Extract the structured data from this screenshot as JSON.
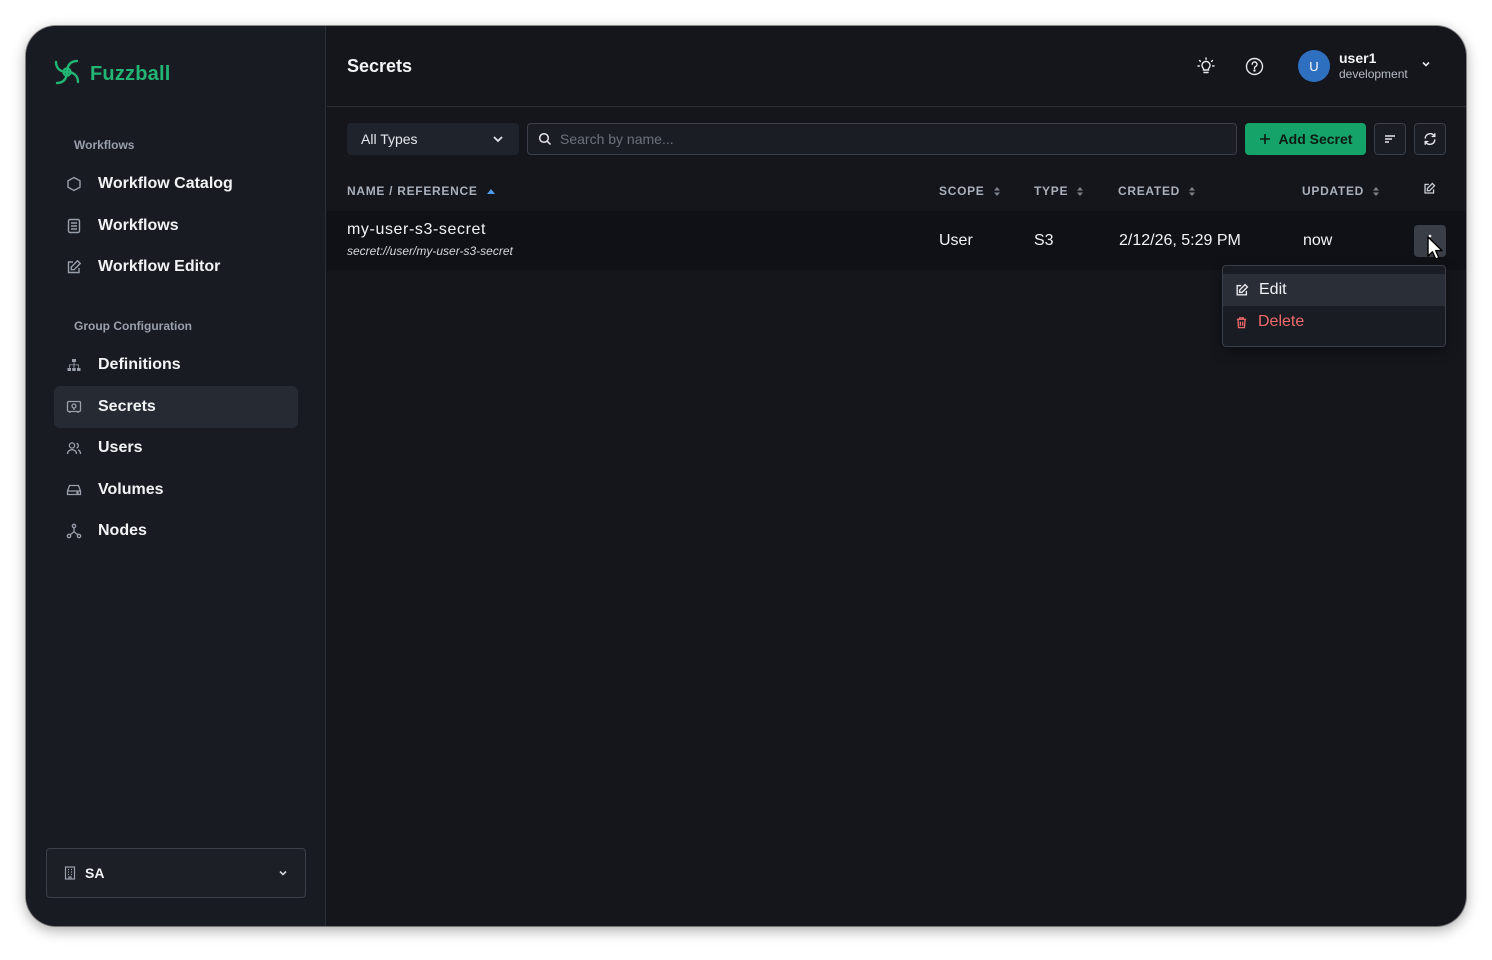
{
  "app": {
    "name": "Fuzzball",
    "brand_color": "#22b573"
  },
  "sidebar": {
    "sections": [
      {
        "label": "Workflows",
        "items": [
          {
            "label": "Workflow Catalog",
            "icon": "hexagon-icon"
          },
          {
            "label": "Workflows",
            "icon": "list-icon"
          },
          {
            "label": "Workflow Editor",
            "icon": "edit-icon"
          }
        ]
      },
      {
        "label": "Group Configuration",
        "items": [
          {
            "label": "Definitions",
            "icon": "sitemap-icon"
          },
          {
            "label": "Secrets",
            "icon": "secret-icon",
            "active": true
          },
          {
            "label": "Users",
            "icon": "users-icon"
          },
          {
            "label": "Volumes",
            "icon": "hard-drive-icon"
          },
          {
            "label": "Nodes",
            "icon": "nodes-icon"
          }
        ]
      }
    ],
    "org": "SA"
  },
  "header": {
    "title": "Secrets",
    "user": {
      "initial": "U",
      "name": "user1",
      "env": "development"
    }
  },
  "toolbar": {
    "type_filter": "All Types",
    "search_placeholder": "Search by name...",
    "add_label": "Add Secret"
  },
  "table": {
    "columns": [
      "NAME / REFERENCE",
      "SCOPE",
      "TYPE",
      "CREATED",
      "UPDATED"
    ],
    "rows": [
      {
        "name": "my-user-s3-secret",
        "reference": "secret://user/my-user-s3-secret",
        "scope": "User",
        "type": "S3",
        "created": "2/12/26, 5:29 PM",
        "updated": "now"
      }
    ]
  },
  "row_menu": {
    "edit": "Edit",
    "delete": "Delete"
  }
}
